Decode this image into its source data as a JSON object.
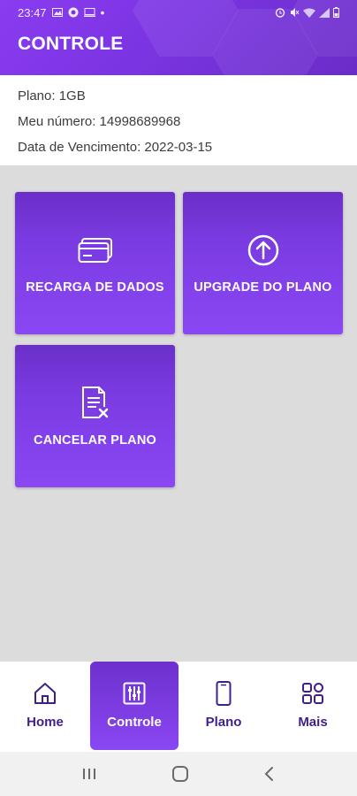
{
  "status_bar": {
    "time": "23:47",
    "left_icons": [
      "image-icon",
      "circle-icon",
      "screen-icon",
      "dot-icon"
    ],
    "right_icons": [
      "alarm-icon",
      "mute-icon",
      "wifi-icon",
      "signal-icon",
      "battery-icon"
    ]
  },
  "header": {
    "title": "CONTROLE",
    "gradient": [
      "#8a3cf0",
      "#6a2cc8"
    ]
  },
  "plan_info": {
    "plan": "Plano: 1GB",
    "number": "Meu número: 14998689968",
    "due_date": "Data de Vencimento: 2022-03-15"
  },
  "tiles": [
    {
      "label": "RECARGA DE DADOS",
      "icon": "credit-card-icon"
    },
    {
      "label": "UPGRADE DO PLANO",
      "icon": "arrow-up-circle-icon"
    },
    {
      "label": "CANCELAR PLANO",
      "icon": "cancel-document-icon"
    }
  ],
  "bottom_nav": {
    "items": [
      {
        "label": "Home",
        "icon": "home-icon",
        "active": false
      },
      {
        "label": "Controle",
        "icon": "sliders-icon",
        "active": true
      },
      {
        "label": "Plano",
        "icon": "phone-icon",
        "active": false
      },
      {
        "label": "Mais",
        "icon": "grid-icon",
        "active": false
      }
    ]
  },
  "system_nav": {
    "buttons": [
      "recents-button",
      "home-button",
      "back-button"
    ]
  },
  "colors": {
    "accent": "#7b3be2",
    "nav_text": "#3f1f8c",
    "background": "#dcdcdc"
  }
}
